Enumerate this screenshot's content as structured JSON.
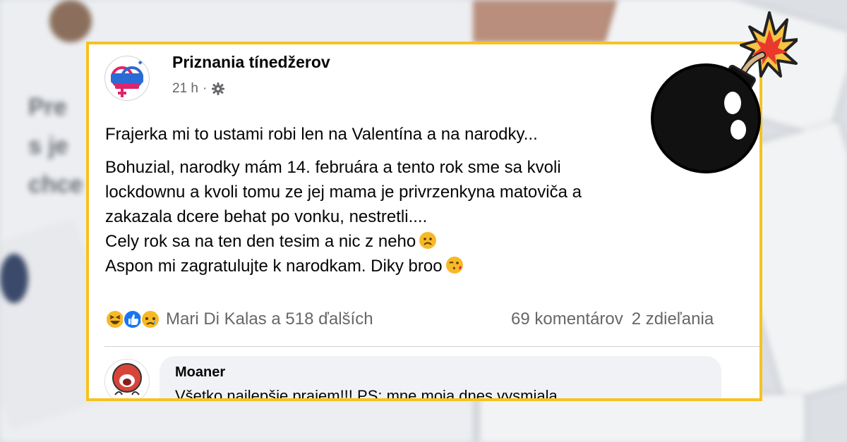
{
  "post": {
    "page_name": "Priznania tínedžerov",
    "time": "21 h",
    "separator": "·",
    "audience_icon": "gear-icon",
    "paragraph1": "Frajerka mi to ustami robi len na Valentína a na narodky...",
    "paragraph2_line1": "Bohuzial, narodky mám 14. februára a tento rok sme sa kvoli",
    "paragraph2_line2": "lockdownu a kvoli tomu ze jej mama je privrzenkyna matoviča a",
    "paragraph2_line3": "zakazala dcere behat po vonku, nestretli....",
    "paragraph2_line4": "Cely rok sa na ten den tesim a nic z neho",
    "paragraph2_line5": "Aspon mi zagratulujte k narodkam. Diky broo",
    "emoji_sad": "frowning-face-emoji",
    "emoji_kiss": "face-blowing-kiss-emoji"
  },
  "reactions": {
    "icons": [
      "haha-reaction-icon",
      "like-reaction-icon",
      "sad-reaction-icon"
    ],
    "reactors_text": "Mari Di Kalas a 518 ďalších",
    "comments_count": "69 komentárov",
    "shares_count": "2 zdieľania"
  },
  "comment": {
    "author": "Moaner",
    "text": "Všetko najlepšie prajem!!! PS: mne moja dnes vysmiala"
  },
  "colors": {
    "frame": "#f7c21e",
    "text_primary": "#050505",
    "text_secondary": "#65676b",
    "like_blue": "#1877f2",
    "reaction_yellow": "#f7b928"
  },
  "decoration": {
    "bomb_icon": "bomb-icon",
    "explosion_icon": "explosion-icon"
  }
}
